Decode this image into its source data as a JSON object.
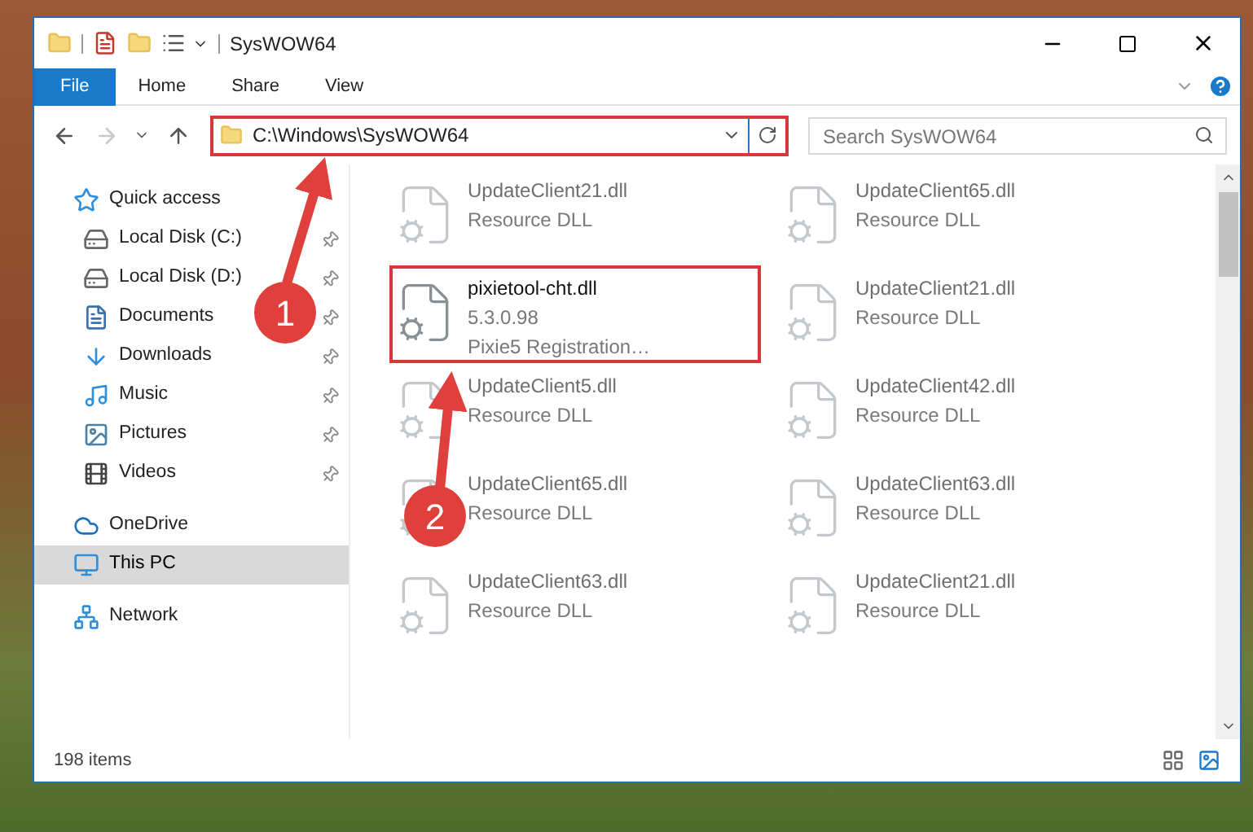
{
  "window": {
    "title": "SysWOW64"
  },
  "ribbon_tabs": [
    {
      "label": "File",
      "kind": "file"
    },
    {
      "label": "Home",
      "kind": "tab"
    },
    {
      "label": "Share",
      "kind": "tab"
    },
    {
      "label": "View",
      "kind": "tab"
    }
  ],
  "nav_buttons": [
    {
      "kind": "back",
      "disabled": false
    },
    {
      "kind": "forward",
      "disabled": true
    },
    {
      "kind": "recent",
      "disabled": false
    },
    {
      "kind": "up",
      "disabled": false
    }
  ],
  "address_bar": {
    "path": "C:\\Windows\\SysWOW64",
    "highlighted": true
  },
  "search": {
    "placeholder": "Search SysWOW64"
  },
  "sidebar": [
    {
      "label": "Quick access",
      "kind": "star",
      "selected": false,
      "children": [
        {
          "label": "Local Disk (C:)",
          "kind": "drive",
          "selected": false,
          "pinned": true
        },
        {
          "label": "Local Disk (D:)",
          "kind": "drive",
          "selected": false,
          "pinned": true
        },
        {
          "label": "Documents",
          "kind": "document",
          "selected": false,
          "pinned": true
        },
        {
          "label": "Downloads",
          "kind": "download",
          "selected": false,
          "pinned": true
        },
        {
          "label": "Music",
          "kind": "music",
          "selected": false,
          "pinned": true
        },
        {
          "label": "Pictures",
          "kind": "picture",
          "selected": false,
          "pinned": true
        },
        {
          "label": "Videos",
          "kind": "video",
          "selected": false,
          "pinned": true
        }
      ]
    },
    {
      "label": "OneDrive",
      "kind": "cloud",
      "selected": false
    },
    {
      "label": "This PC",
      "kind": "pc",
      "selected": true
    },
    {
      "label": "Network",
      "kind": "network",
      "selected": false
    }
  ],
  "files": [
    {
      "name": "UpdateClient21.dll",
      "details": [
        "Resource DLL"
      ],
      "blurred": true,
      "highlighted": false
    },
    {
      "name": "UpdateClient65.dll",
      "details": [
        "Resource DLL"
      ],
      "blurred": true,
      "highlighted": false
    },
    {
      "name": "pixietool-cht.dll",
      "details": [
        "5.3.0.98",
        "Pixie5 Registration…"
      ],
      "blurred": false,
      "highlighted": true
    },
    {
      "name": "UpdateClient21.dll",
      "details": [
        "Resource DLL"
      ],
      "blurred": true,
      "highlighted": false
    },
    {
      "name": "UpdateClient5.dll",
      "details": [
        "Resource DLL"
      ],
      "blurred": true,
      "highlighted": false
    },
    {
      "name": "UpdateClient42.dll",
      "details": [
        "Resource DLL"
      ],
      "blurred": true,
      "highlighted": false
    },
    {
      "name": "UpdateClient65.dll",
      "details": [
        "Resource DLL"
      ],
      "blurred": true,
      "highlighted": false
    },
    {
      "name": "UpdateClient63.dll",
      "details": [
        "Resource DLL"
      ],
      "blurred": true,
      "highlighted": false
    },
    {
      "name": "UpdateClient63.dll",
      "details": [
        "Resource DLL"
      ],
      "blurred": true,
      "highlighted": false
    },
    {
      "name": "UpdateClient21.dll",
      "details": [
        "Resource DLL"
      ],
      "blurred": true,
      "highlighted": false
    }
  ],
  "status_bar": {
    "item_count": "198 items"
  },
  "callouts": [
    {
      "number": "1"
    },
    {
      "number": "2"
    }
  ]
}
